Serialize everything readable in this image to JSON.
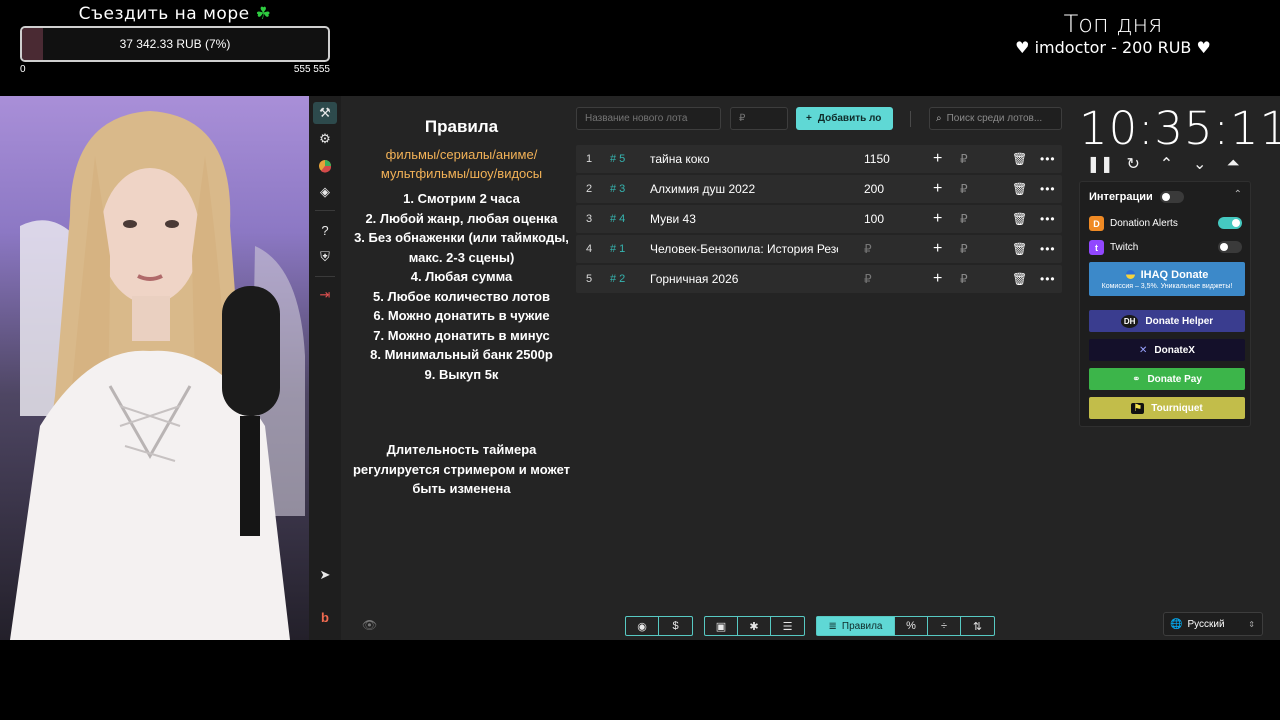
{
  "goal": {
    "title": "Съездить на море",
    "amount": "37 342.33 RUB (7%)",
    "progress": 0.07,
    "min": "0",
    "max": "555 555"
  },
  "top_day": {
    "title": "Топ дня",
    "line": "imdoctor - 200 RUB"
  },
  "rules": {
    "title": "Правила",
    "genres": "фильмы/сериалы/аниме/мультфильмы/шоу/видосы",
    "items": [
      "1. Смотрим 2 часа",
      "2. Любой жанр, любая оценка",
      "3. Без обнаженки (или таймкоды, макс. 2-3 сцены)",
      "4. Любая сумма",
      "5. Любое количество лотов",
      "6. Можно донатить в чужие",
      "7. Можно донатить в минус",
      "8. Минимальный банк 2500р",
      "9. Выкуп 5к"
    ],
    "note": "Длительность таймера регулируется стримером и может быть изменена"
  },
  "toolbar": {
    "new_lot_placeholder": "Название нового лота",
    "amount_placeholder": "₽",
    "add_label": "Добавить ло",
    "search_placeholder": "Поиск среди лотов..."
  },
  "lots": [
    {
      "num": "1",
      "id": "# 5",
      "name": "тайна коко",
      "amount": "1150"
    },
    {
      "num": "2",
      "id": "# 3",
      "name": "Алхимия душ 2022",
      "amount": "200"
    },
    {
      "num": "3",
      "id": "# 4",
      "name": "Муви 43",
      "amount": "100"
    },
    {
      "num": "4",
      "id": "# 1",
      "name": "Человек-Бензопила: История Резе",
      "amount": "₽"
    },
    {
      "num": "5",
      "id": "# 2",
      "name": "Горничная 2026",
      "amount": "₽"
    }
  ],
  "lot_currency": "₽",
  "timer": {
    "time": "10:35:11"
  },
  "integrations": {
    "title": "Интеграции",
    "items": [
      {
        "name": "Donation Alerts",
        "enabled": true
      },
      {
        "name": "Twitch",
        "enabled": false
      }
    ],
    "iq": {
      "title": "IHAQ Donate",
      "subtitle": "Комиссия – 3,5%. Уникальные виджеты!"
    },
    "buttons": [
      {
        "label": "Donate Helper",
        "color": "#3a3d8f"
      },
      {
        "label": "DonateX",
        "color": "#14102a"
      },
      {
        "label": "Donate Pay",
        "color": "#3cb54a"
      },
      {
        "label": "Tourniquet",
        "color": "#c2bd4a"
      }
    ]
  },
  "bottom": {
    "rules_label": "Правила"
  },
  "language": "Русский",
  "colors": {
    "accent": "#5fd8d5",
    "genres": "#f3b257",
    "app_bg": "#242424"
  }
}
